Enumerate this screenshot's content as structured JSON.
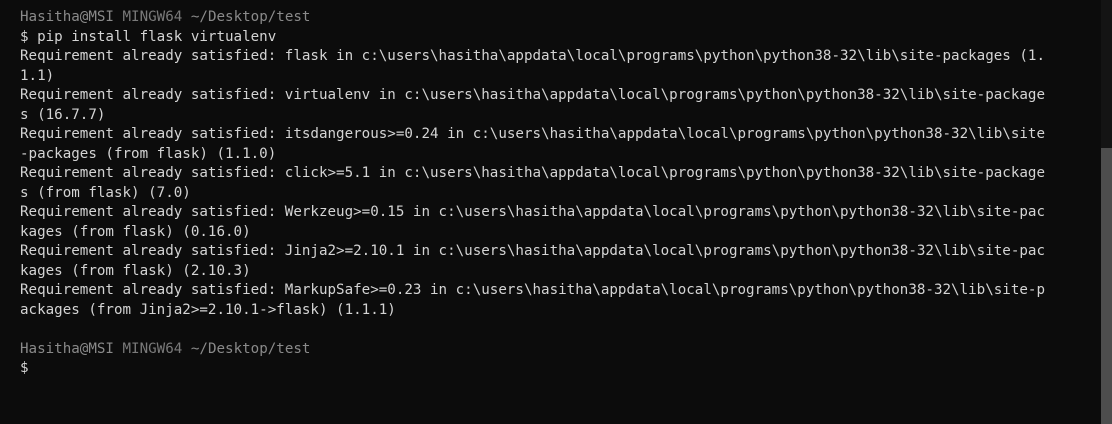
{
  "terminal": {
    "prompt1": {
      "user_host": "Hasitha@MSI",
      "env": "MINGW64",
      "path": "~/Desktop/test"
    },
    "command": "$ pip install flask virtualenv",
    "output_lines": [
      "Requirement already satisfied: flask in c:\\users\\hasitha\\appdata\\local\\programs\\python\\python38-32\\lib\\site-packages (1.",
      "1.1)",
      "Requirement already satisfied: virtualenv in c:\\users\\hasitha\\appdata\\local\\programs\\python\\python38-32\\lib\\site-package",
      "s (16.7.7)",
      "Requirement already satisfied: itsdangerous>=0.24 in c:\\users\\hasitha\\appdata\\local\\programs\\python\\python38-32\\lib\\site",
      "-packages (from flask) (1.1.0)",
      "Requirement already satisfied: click>=5.1 in c:\\users\\hasitha\\appdata\\local\\programs\\python\\python38-32\\lib\\site-package",
      "s (from flask) (7.0)",
      "Requirement already satisfied: Werkzeug>=0.15 in c:\\users\\hasitha\\appdata\\local\\programs\\python\\python38-32\\lib\\site-pac",
      "kages (from flask) (0.16.0)",
      "Requirement already satisfied: Jinja2>=2.10.1 in c:\\users\\hasitha\\appdata\\local\\programs\\python\\python38-32\\lib\\site-pac",
      "kages (from flask) (2.10.3)",
      "Requirement already satisfied: MarkupSafe>=0.23 in c:\\users\\hasitha\\appdata\\local\\programs\\python\\python38-32\\lib\\site-p",
      "ackages (from Jinja2>=2.10.1->flask) (1.1.1)"
    ],
    "prompt2": {
      "user_host": "Hasitha@MSI",
      "env": "MINGW64",
      "path": "~/Desktop/test"
    },
    "current_input": "$"
  }
}
